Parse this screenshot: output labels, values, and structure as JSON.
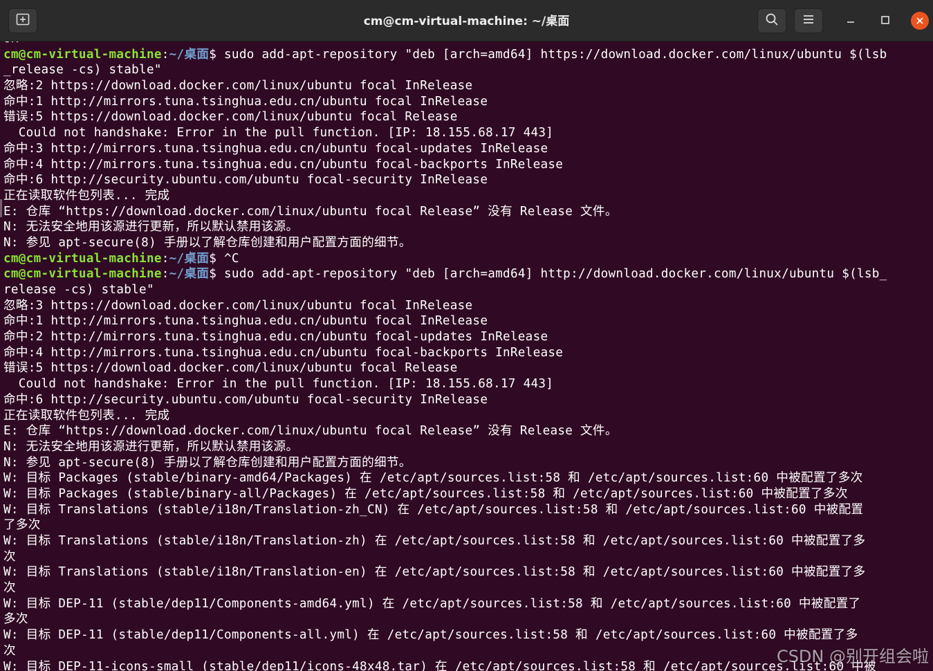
{
  "window": {
    "title": "cm@cm-virtual-machine: ~/桌面",
    "icons": {
      "new_tab": "new-tab-icon",
      "search": "search-icon",
      "menu": "hamburger-menu-icon",
      "minimize": "minimize-icon",
      "maximize": "maximize-icon",
      "close": "close-icon"
    },
    "colors": {
      "titlebar": "#2b2b2b",
      "terminal_bg": "#300a24",
      "prompt_user": "#8ae234",
      "prompt_path": "#729fcf",
      "close": "#e95420"
    }
  },
  "prompt": {
    "user": "cm@cm-virtual-machine",
    "colon": ":",
    "path": "~/桌面",
    "dollar": "$"
  },
  "terminal": {
    "lines": [
      {
        "text": "OK"
      },
      {
        "prompt": true,
        "cmd": " sudo add-apt-repository \"deb [arch=amd64] https://download.docker.com/linux/ubuntu $(lsb"
      },
      {
        "text": "_release -cs) stable\""
      },
      {
        "text": "忽略:2 https://download.docker.com/linux/ubuntu focal InRelease"
      },
      {
        "text": "命中:1 http://mirrors.tuna.tsinghua.edu.cn/ubuntu focal InRelease"
      },
      {
        "text": "错误:5 https://download.docker.com/linux/ubuntu focal Release"
      },
      {
        "text": "  Could not handshake: Error in the pull function. [IP: 18.155.68.17 443]"
      },
      {
        "text": "命中:3 http://mirrors.tuna.tsinghua.edu.cn/ubuntu focal-updates InRelease"
      },
      {
        "text": "命中:4 http://mirrors.tuna.tsinghua.edu.cn/ubuntu focal-backports InRelease"
      },
      {
        "text": "命中:6 http://security.ubuntu.com/ubuntu focal-security InRelease"
      },
      {
        "text": "正在读取软件包列表... 完成"
      },
      {
        "text": "E: 仓库 “https://download.docker.com/linux/ubuntu focal Release” 没有 Release 文件。"
      },
      {
        "text": "N: 无法安全地用该源进行更新，所以默认禁用该源。"
      },
      {
        "text": "N: 参见 apt-secure(8) 手册以了解仓库创建和用户配置方面的细节。"
      },
      {
        "prompt": true,
        "cmd": " ^C"
      },
      {
        "prompt": true,
        "cmd": " sudo add-apt-repository \"deb [arch=amd64] http://download.docker.com/linux/ubuntu $(lsb_"
      },
      {
        "text": "release -cs) stable\""
      },
      {
        "text": "忽略:3 https://download.docker.com/linux/ubuntu focal InRelease"
      },
      {
        "text": "命中:1 http://mirrors.tuna.tsinghua.edu.cn/ubuntu focal InRelease"
      },
      {
        "text": "命中:2 http://mirrors.tuna.tsinghua.edu.cn/ubuntu focal-updates InRelease"
      },
      {
        "text": "命中:4 http://mirrors.tuna.tsinghua.edu.cn/ubuntu focal-backports InRelease"
      },
      {
        "text": "错误:5 https://download.docker.com/linux/ubuntu focal Release"
      },
      {
        "text": "  Could not handshake: Error in the pull function. [IP: 18.155.68.17 443]"
      },
      {
        "text": "命中:6 http://security.ubuntu.com/ubuntu focal-security InRelease"
      },
      {
        "text": "正在读取软件包列表... 完成"
      },
      {
        "text": "E: 仓库 “https://download.docker.com/linux/ubuntu focal Release” 没有 Release 文件。"
      },
      {
        "text": "N: 无法安全地用该源进行更新，所以默认禁用该源。"
      },
      {
        "text": "N: 参见 apt-secure(8) 手册以了解仓库创建和用户配置方面的细节。"
      },
      {
        "text": "W: 目标 Packages (stable/binary-amd64/Packages) 在 /etc/apt/sources.list:58 和 /etc/apt/sources.list:60 中被配置了多次"
      },
      {
        "text": "W: 目标 Packages (stable/binary-all/Packages) 在 /etc/apt/sources.list:58 和 /etc/apt/sources.list:60 中被配置了多次"
      },
      {
        "text": "W: 目标 Translations (stable/i18n/Translation-zh_CN) 在 /etc/apt/sources.list:58 和 /etc/apt/sources.list:60 中被配置"
      },
      {
        "text": "了多次"
      },
      {
        "text": "W: 目标 Translations (stable/i18n/Translation-zh) 在 /etc/apt/sources.list:58 和 /etc/apt/sources.list:60 中被配置了多"
      },
      {
        "text": "次"
      },
      {
        "text": "W: 目标 Translations (stable/i18n/Translation-en) 在 /etc/apt/sources.list:58 和 /etc/apt/sources.list:60 中被配置了多"
      },
      {
        "text": "次"
      },
      {
        "text": "W: 目标 DEP-11 (stable/dep11/Components-amd64.yml) 在 /etc/apt/sources.list:58 和 /etc/apt/sources.list:60 中被配置了"
      },
      {
        "text": "多次"
      },
      {
        "text": "W: 目标 DEP-11 (stable/dep11/Components-all.yml) 在 /etc/apt/sources.list:58 和 /etc/apt/sources.list:60 中被配置了多"
      },
      {
        "text": "次"
      },
      {
        "text": "W: 目标 DEP-11-icons-small (stable/dep11/icons-48x48.tar) 在 /etc/apt/sources.list:58 和 /etc/apt/sources.list:60 中被"
      }
    ]
  },
  "watermark": "CSDN @别开组会啦"
}
